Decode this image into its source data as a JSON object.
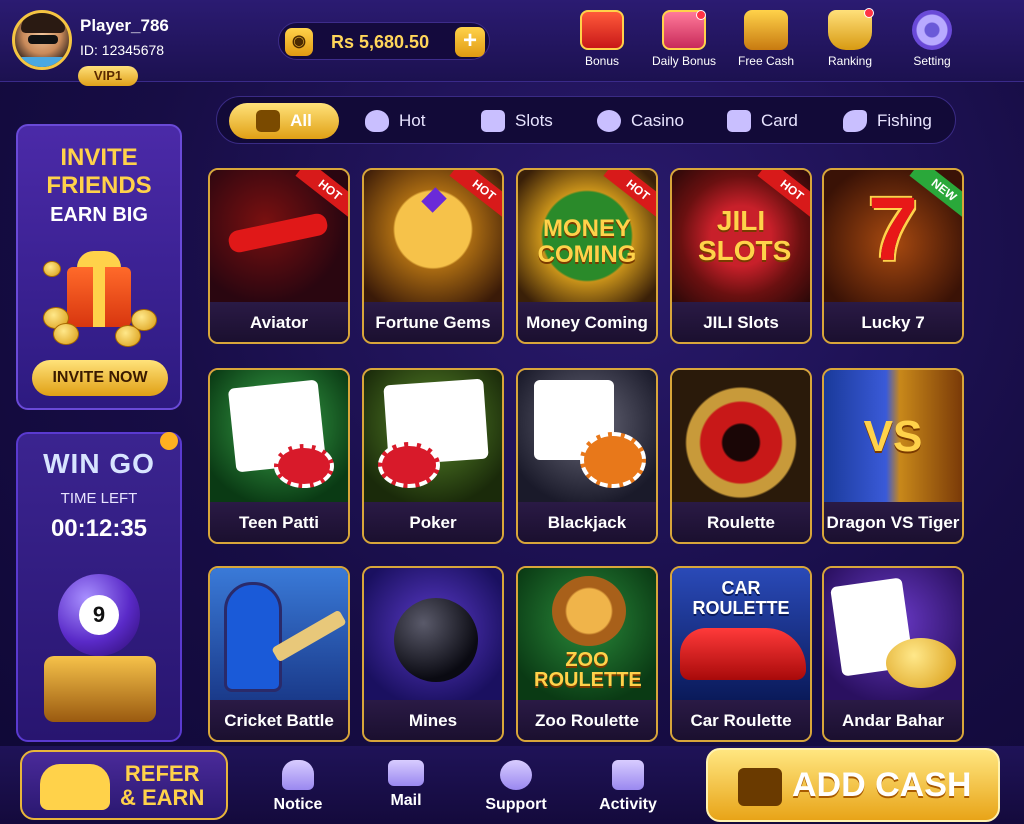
{
  "player": {
    "name": "Player_786",
    "id": "ID: 12345678",
    "vip": "VIP1"
  },
  "balance": {
    "amount": "Rs 5,680.50",
    "add_symbol": "+",
    "icon": "wallet-icon"
  },
  "top_nav": [
    {
      "label": "Bonus",
      "icon": "gift-icon",
      "dot": false
    },
    {
      "label": "Daily Bonus",
      "icon": "calendar-gift-icon",
      "dot": true
    },
    {
      "label": "Free Cash",
      "icon": "treasure-icon",
      "dot": false
    },
    {
      "label": "Ranking",
      "icon": "trophy-icon",
      "dot": true
    },
    {
      "label": "Setting",
      "icon": "gear-icon",
      "dot": false
    }
  ],
  "categories": [
    {
      "label": "All",
      "icon": "grid-icon",
      "active": true
    },
    {
      "label": "Hot",
      "icon": "flame-icon",
      "active": false
    },
    {
      "label": "Slots",
      "icon": "slot-machine-icon",
      "active": false
    },
    {
      "label": "Casino",
      "icon": "chip-icon",
      "active": false
    },
    {
      "label": "Card",
      "icon": "cards-icon",
      "active": false
    },
    {
      "label": "Fishing",
      "icon": "fish-icon",
      "active": false
    }
  ],
  "invite": {
    "line1": "INVITE",
    "line2": "FRIENDS",
    "line3": "EARN BIG",
    "button": "INVITE NOW"
  },
  "wingo": {
    "title": "WIN GO",
    "time_label": "TIME LEFT",
    "time": "00:12:35",
    "ball_number": "9"
  },
  "games": [
    {
      "name": "Aviator",
      "tag": "HOT",
      "art_text": ""
    },
    {
      "name": "Fortune Gems",
      "tag": "HOT",
      "art_text": ""
    },
    {
      "name": "Money Coming",
      "tag": "HOT",
      "art_text": "MONEY COMING"
    },
    {
      "name": "JILI Slots",
      "tag": "HOT",
      "art_text": "JILI SLOTS"
    },
    {
      "name": "Lucky 7",
      "tag": "NEW",
      "art_text": "7"
    },
    {
      "name": "Teen Patti",
      "tag": "",
      "art_text": ""
    },
    {
      "name": "Poker",
      "tag": "",
      "art_text": ""
    },
    {
      "name": "Blackjack",
      "tag": "",
      "art_text": ""
    },
    {
      "name": "Roulette",
      "tag": "",
      "art_text": ""
    },
    {
      "name": "Dragon VS Tiger",
      "tag": "",
      "art_text": "VS"
    },
    {
      "name": "Cricket Battle",
      "tag": "",
      "art_text": ""
    },
    {
      "name": "Mines",
      "tag": "",
      "art_text": ""
    },
    {
      "name": "Zoo Roulette",
      "tag": "",
      "art_text": "ZOO ROULETTE"
    },
    {
      "name": "Car Roulette",
      "tag": "",
      "art_text": "CAR ROULETTE"
    },
    {
      "name": "Andar Bahar",
      "tag": "",
      "art_text": ""
    }
  ],
  "bottom_nav": {
    "refer": {
      "line1": "REFER",
      "line2": "& EARN"
    },
    "items": [
      {
        "label": "Notice",
        "icon": "bell-icon"
      },
      {
        "label": "Mail",
        "icon": "mail-icon"
      },
      {
        "label": "Support",
        "icon": "headset-icon"
      },
      {
        "label": "Activity",
        "icon": "gift-box-icon"
      }
    ],
    "add_cash": "ADD CASH"
  }
}
